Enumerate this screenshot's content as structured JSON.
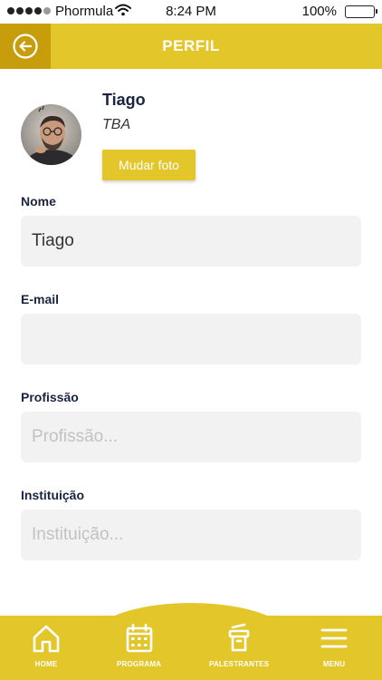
{
  "status_bar": {
    "carrier": "Phormula",
    "time": "8:24 PM",
    "battery": "100%"
  },
  "header": {
    "title": "PERFIL",
    "back_icon": "back-arrow-circle-icon"
  },
  "profile": {
    "name": "Tiago",
    "subtitle": "TBA",
    "change_photo_label": "Mudar foto"
  },
  "fields": {
    "nome": {
      "label": "Nome",
      "value": "Tiago",
      "placeholder": ""
    },
    "email": {
      "label": "E-mail",
      "value": "",
      "placeholder": ""
    },
    "profissao": {
      "label": "Profissão",
      "value": "",
      "placeholder": "Profissão..."
    },
    "instituicao": {
      "label": "Instituição",
      "value": "",
      "placeholder": "Instituição..."
    }
  },
  "nav": {
    "items": [
      {
        "label": "HOME",
        "icon": "home-icon"
      },
      {
        "label": "PROGRAMA",
        "icon": "calendar-icon"
      },
      {
        "label": "PALESTRANTES",
        "icon": "podium-icon"
      },
      {
        "label": "MENU",
        "icon": "hamburger-menu-icon"
      }
    ]
  },
  "colors": {
    "accent": "#e3c62a",
    "accent_dark": "#c89d0c",
    "text_dark": "#1a2340",
    "input_bg": "#f2f2f2"
  }
}
